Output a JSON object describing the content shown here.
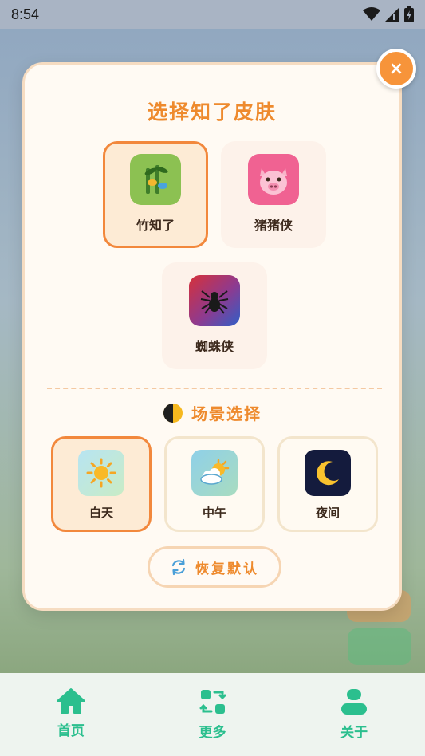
{
  "status_bar": {
    "time": "8:54"
  },
  "dialog": {
    "title": "选择知了皮肤",
    "close_label": "×",
    "skins": [
      {
        "label": "竹知了",
        "icon": "bamboo-icon",
        "selected": true
      },
      {
        "label": "猪猪侠",
        "icon": "pig-icon",
        "selected": false
      },
      {
        "label": "蜘蛛侠",
        "icon": "spider-icon",
        "selected": false
      }
    ],
    "scene_title": "场景选择",
    "scenes": [
      {
        "label": "白天",
        "icon": "sun-icon",
        "selected": true
      },
      {
        "label": "中午",
        "icon": "sun-cloud-icon",
        "selected": false
      },
      {
        "label": "夜间",
        "icon": "moon-icon",
        "selected": false
      }
    ],
    "reset_label": "恢复默认"
  },
  "bottom_nav": [
    {
      "label": "首页",
      "icon": "home-icon"
    },
    {
      "label": "更多",
      "icon": "more-icon"
    },
    {
      "label": "关于",
      "icon": "user-icon"
    }
  ],
  "colors": {
    "accent": "#ee8a2d",
    "nav_green": "#2bbf8e",
    "close_button": "#f7943a"
  }
}
